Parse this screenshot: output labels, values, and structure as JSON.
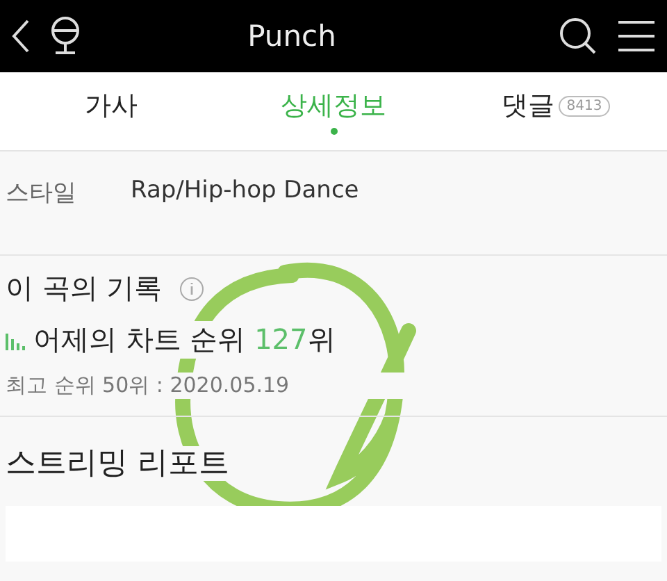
{
  "header": {
    "title": "Punch"
  },
  "tabs": [
    {
      "label": "가사",
      "selected": false
    },
    {
      "label": "상세정보",
      "selected": true
    },
    {
      "label": "댓글",
      "badge": "8413",
      "selected": false
    }
  ],
  "details": [
    {
      "label": "스타일",
      "value": "Rap/Hip-hop Dance"
    }
  ],
  "record": {
    "title": "이 곡의 기록",
    "chart_prefix": "어제의 차트 순위 ",
    "chart_rank": "127",
    "chart_suffix": "위",
    "best": "최고 순위 50위 : 2020.05.19"
  },
  "streaming": {
    "title": "스트리밍 리포트"
  }
}
